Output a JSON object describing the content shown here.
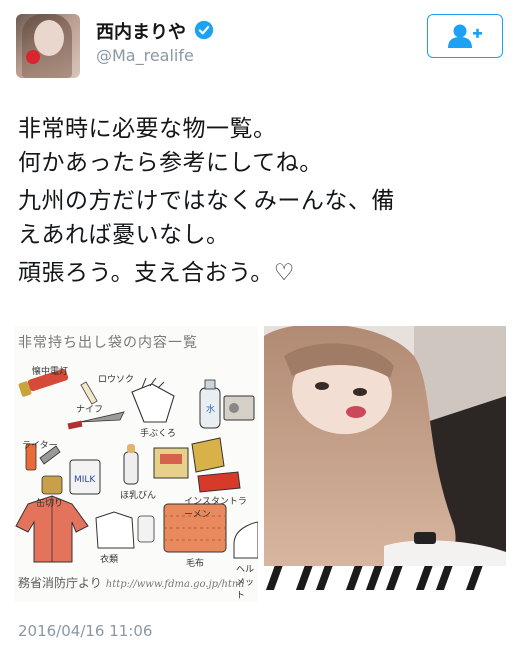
{
  "user": {
    "display_name": "西内まりや",
    "handle": "@Ma_realife",
    "verified": true,
    "verified_icon": "verified-badge-icon",
    "avatar_icon": "profile-photo"
  },
  "follow_button": {
    "icon": "add-user-icon",
    "accent_color": "#1da1f2"
  },
  "tweet": {
    "lines": [
      "非常時に必要な物一覧。",
      "何かあったら参考にしてね。",
      "九州の方だけではなくみーんな、備",
      "えあれば憂いなし。",
      "頑張ろう。支え合おう。♡"
    ],
    "timestamp": "2016/04/16 11:06"
  },
  "media": {
    "left_image": {
      "title": "非常持ち出し袋の内容一覧",
      "items": [
        "懐中電灯",
        "ロウソク",
        "ナイフ",
        "手ぶくろ",
        "ライター",
        "缶切り",
        "ほ乳びん",
        "インスタントラーメン",
        "衣類",
        "毛布",
        "ヘルメット",
        "水"
      ],
      "source": "務省消防庁より",
      "url": "http://www.fdma.go.jp/html"
    },
    "right_image": {
      "description_icon": "selfie-photo"
    }
  },
  "colors": {
    "text": "#14171a",
    "secondary": "#8899a6",
    "accent": "#1da1f2"
  }
}
